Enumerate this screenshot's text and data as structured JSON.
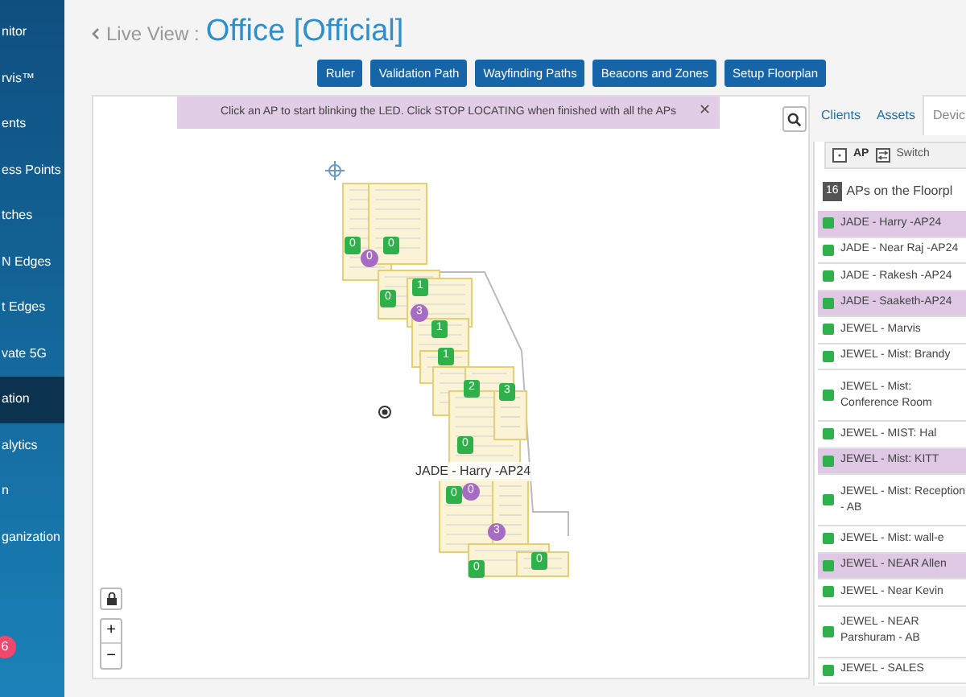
{
  "sidebar": {
    "items": [
      {
        "label": "nitor",
        "selected": false
      },
      {
        "label": "rvis™",
        "selected": false
      },
      {
        "label": "ents",
        "selected": false
      },
      {
        "label": "ess Points",
        "selected": false
      },
      {
        "label": "tches",
        "selected": false
      },
      {
        "label": "N Edges",
        "selected": false
      },
      {
        "label": "t Edges",
        "selected": false
      },
      {
        "label": "vate 5G",
        "selected": false
      },
      {
        "label": "ation",
        "selected": true
      },
      {
        "label": "alytics",
        "selected": false
      },
      {
        "label": "n",
        "selected": false
      },
      {
        "label": "ganization",
        "selected": false
      }
    ],
    "badge": "6"
  },
  "header": {
    "back": "Live View :",
    "title": "Office [Official]"
  },
  "toolbar": [
    "Ruler",
    "Validation Path",
    "Wayfinding Paths",
    "Beacons and Zones",
    "Setup Floorplan"
  ],
  "banner": {
    "text": "Click an AP to start blinking the LED. Click STOP LOCATING when finished with all the APs",
    "close": "✕"
  },
  "map": {
    "label": "JADE - Harry -AP24",
    "markers": [
      {
        "count": "0",
        "selected": false
      },
      {
        "count": "0",
        "selected": false
      },
      {
        "count": "0",
        "selected": true
      },
      {
        "count": "0",
        "selected": false
      },
      {
        "count": "1",
        "selected": false
      },
      {
        "count": "3",
        "selected": true
      },
      {
        "count": "1",
        "selected": false
      },
      {
        "count": "1",
        "selected": false
      },
      {
        "count": "2",
        "selected": false
      },
      {
        "count": "3",
        "selected": false
      },
      {
        "count": "0",
        "selected": false
      },
      {
        "count": "0",
        "selected": false
      },
      {
        "count": "0",
        "selected": true
      },
      {
        "count": "3",
        "selected": true
      },
      {
        "count": "0",
        "selected": false
      },
      {
        "count": "0",
        "selected": false
      }
    ],
    "zoom_in": "+",
    "zoom_out": "−"
  },
  "panel": {
    "tabs": [
      {
        "label": "Clients",
        "selected": false
      },
      {
        "label": "Assets",
        "selected": false
      },
      {
        "label": "Devic",
        "selected": true
      }
    ],
    "filters": [
      {
        "label": "AP"
      },
      {
        "label": "Switch"
      }
    ],
    "count": "16",
    "heading": "APs on the Floorpl",
    "aps": [
      {
        "name": "JADE - Harry -AP24",
        "selected": true
      },
      {
        "name": "JADE - Near Raj -AP24",
        "selected": false
      },
      {
        "name": "JADE - Rakesh -AP24",
        "selected": false
      },
      {
        "name": "JADE - Saaketh-AP24",
        "selected": true
      },
      {
        "name": "JEWEL - Marvis",
        "selected": false
      },
      {
        "name": "JEWEL - Mist: Brandy",
        "selected": false
      },
      {
        "name": "JEWEL - Mist: Conference Room",
        "selected": false
      },
      {
        "name": "JEWEL - MIST: Hal",
        "selected": false
      },
      {
        "name": "JEWEL - Mist: KITT",
        "selected": true
      },
      {
        "name": "JEWEL - Mist: Reception - AB",
        "selected": false
      },
      {
        "name": "JEWEL - Mist: wall-e",
        "selected": false
      },
      {
        "name": "JEWEL - NEAR Allen",
        "selected": true
      },
      {
        "name": "JEWEL - Near Kevin",
        "selected": false
      },
      {
        "name": "JEWEL - NEAR Parshuram - AB",
        "selected": false
      },
      {
        "name": "JEWEL - SALES",
        "selected": false
      }
    ]
  }
}
